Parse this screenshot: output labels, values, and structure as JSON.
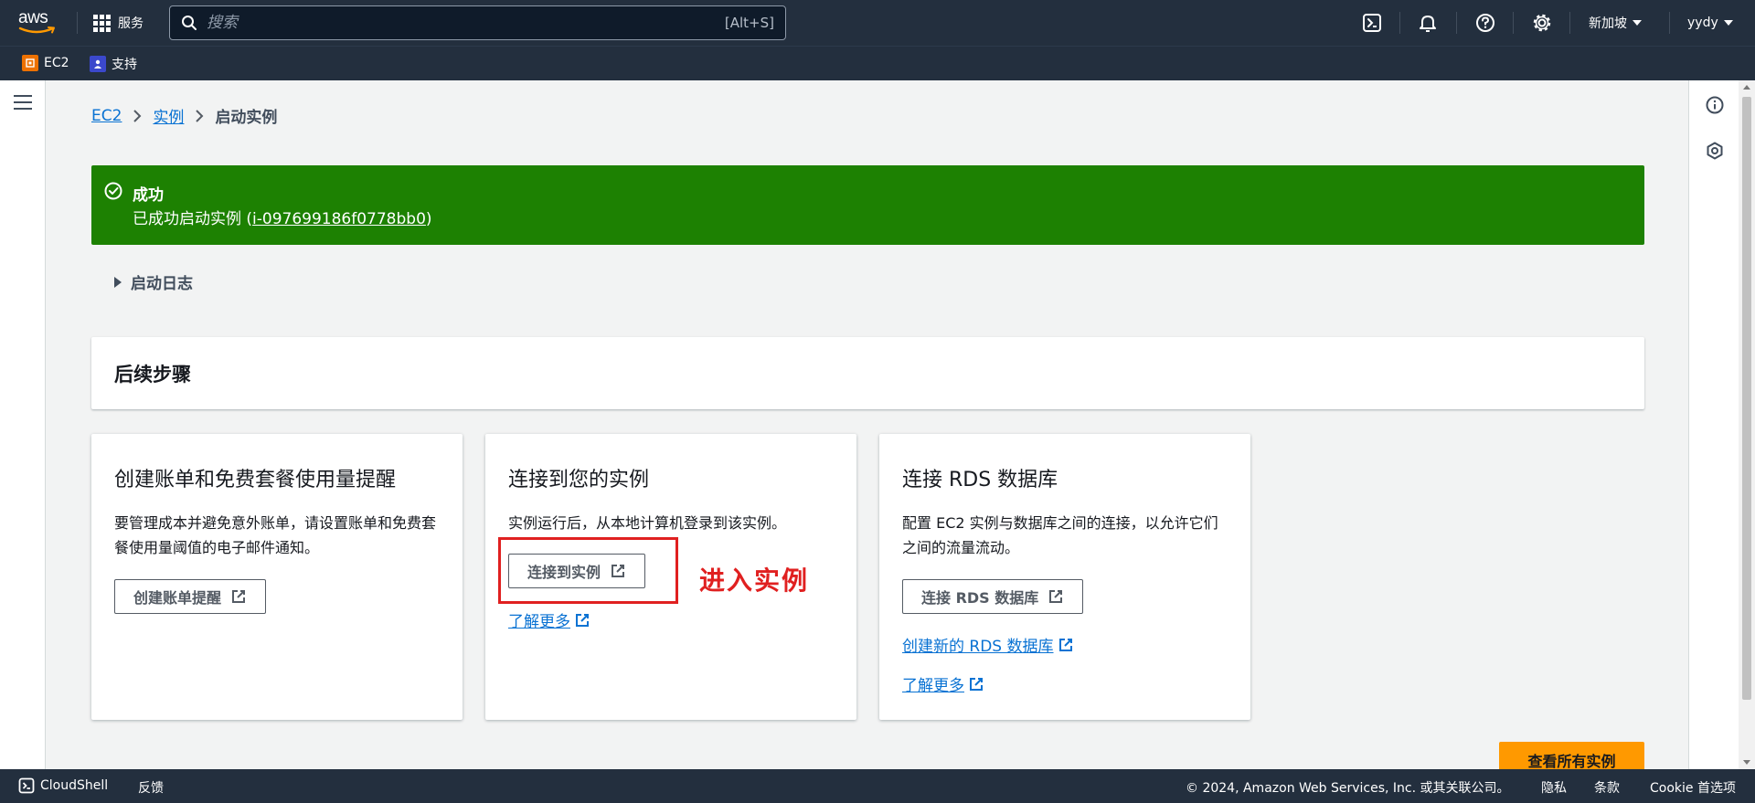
{
  "topnav": {
    "logo_text": "aws",
    "services_label": "服务",
    "search_placeholder": "搜索",
    "search_shortcut": "[Alt+S]",
    "region_label": "新加坡",
    "account_label": "yydy"
  },
  "favorites": [
    {
      "label": "EC2",
      "color": "#ed7100"
    },
    {
      "label": "支持",
      "color": "#3b48cc"
    }
  ],
  "breadcrumb": {
    "items": [
      "EC2",
      "实例"
    ],
    "current": "启动实例"
  },
  "flash": {
    "title": "成功",
    "message_prefix": "已成功启动实例 (",
    "instance_id": "i-097699186f0778bb0",
    "message_suffix": ")",
    "color": "#1d8102"
  },
  "launch_log": {
    "label": "启动日志"
  },
  "next_steps": {
    "title": "后续步骤",
    "cards": [
      {
        "title": "创建账单和免费套餐使用量提醒",
        "description": "要管理成本并避免意外账单，请设置账单和免费套餐使用量阈值的电子邮件通知。",
        "button_label": "创建账单提醒"
      },
      {
        "title": "连接到您的实例",
        "description": "实例运行后，从本地计算机登录到该实例。",
        "button_label": "连接到实例",
        "link_label": "了解更多"
      },
      {
        "title": "连接 RDS 数据库",
        "description": "配置 EC2 实例与数据库之间的连接，以允许它们之间的流量流动。",
        "button_label": "连接 RDS 数据库",
        "link1_label": "创建新的 RDS 数据库",
        "link2_label": "了解更多"
      }
    ]
  },
  "annotation": {
    "text": "进入实例",
    "color": "#e02020"
  },
  "view_all_button": "查看所有实例",
  "footer": {
    "cloudshell": "CloudShell",
    "feedback": "反馈",
    "copyright": "© 2024, Amazon Web Services, Inc. 或其关联公司。",
    "privacy": "隐私",
    "terms": "条款",
    "cookie": "Cookie 首选项"
  }
}
